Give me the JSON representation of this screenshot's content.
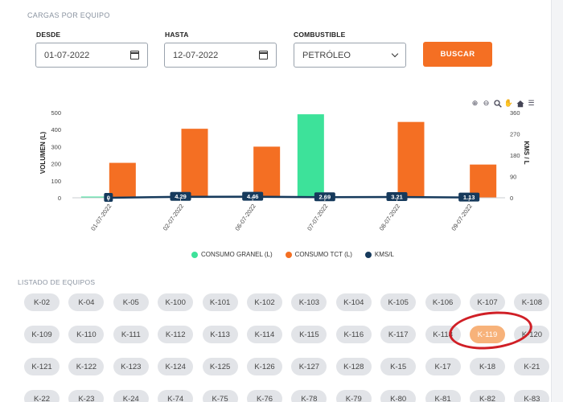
{
  "section_title": "CARGAS POR EQUIPO",
  "filters": {
    "desde_label": "DESDE",
    "desde_value": "01-07-2022",
    "hasta_label": "HASTA",
    "hasta_value": "12-07-2022",
    "combustible_label": "COMBUSTIBLE",
    "combustible_value": "PETRÓLEO",
    "search_label": "BUSCAR"
  },
  "colors": {
    "granel": "#3de29a",
    "tct": "#f46f23",
    "kms": "#163a5c",
    "accent": "#f46f23"
  },
  "chart_data": {
    "type": "bar",
    "categories": [
      "01-07-2022",
      "02-07-2022",
      "06-07-2022",
      "07-07-2022",
      "08-07-2022",
      "09-07-2022"
    ],
    "series": [
      {
        "name": "CONSUMO GRANEL (L)",
        "axis": "left",
        "kind": "bar",
        "values": [
          0,
          0,
          0,
          490,
          0,
          0
        ]
      },
      {
        "name": "CONSUMO TCT (L)",
        "axis": "left",
        "kind": "bar",
        "values": [
          205,
          405,
          300,
          0,
          445,
          195
        ]
      },
      {
        "name": "KMS/L",
        "axis": "right",
        "kind": "line",
        "values": [
          0,
          4.29,
          4.46,
          2.69,
          3.21,
          1.13
        ],
        "labels": [
          "0",
          "4.29",
          "4.46",
          "2.69",
          "3.21",
          "1.13"
        ]
      }
    ],
    "ylabel": "VOLUMEN (L)",
    "y2label": "KMS / L",
    "ylim": [
      0,
      500
    ],
    "y2lim": [
      0,
      360
    ],
    "yticks": [
      "500",
      "400",
      "300",
      "200",
      "100",
      "0"
    ],
    "y2ticks": [
      "360",
      "270",
      "180",
      "90",
      "0"
    ],
    "legend": "bottom",
    "grid": false
  },
  "legend": {
    "granel": "CONSUMO GRANEL (L)",
    "tct": "CONSUMO TCT (L)",
    "kms": "KMS/L"
  },
  "list_title": "LISTADO DE EQUIPOS",
  "equipos": [
    [
      "K-02",
      "K-04",
      "K-05",
      "K-100",
      "K-101",
      "K-102",
      "K-103",
      "K-104",
      "K-105",
      "K-106",
      "K-107",
      "K-108"
    ],
    [
      "K-109",
      "K-110",
      "K-111",
      "K-112",
      "K-113",
      "K-114",
      "K-115",
      "K-116",
      "K-117",
      "K-118",
      "K-119",
      "K-120"
    ],
    [
      "K-121",
      "K-122",
      "K-123",
      "K-124",
      "K-125",
      "K-126",
      "K-127",
      "K-128",
      "K-15",
      "K-17",
      "K-18",
      "K-21"
    ],
    [
      "K-22",
      "K-23",
      "K-24",
      "K-74",
      "K-75",
      "K-76",
      "K-78",
      "K-79",
      "K-80",
      "K-81",
      "K-82",
      "K-83"
    ]
  ],
  "selected_equipo": "K-119"
}
